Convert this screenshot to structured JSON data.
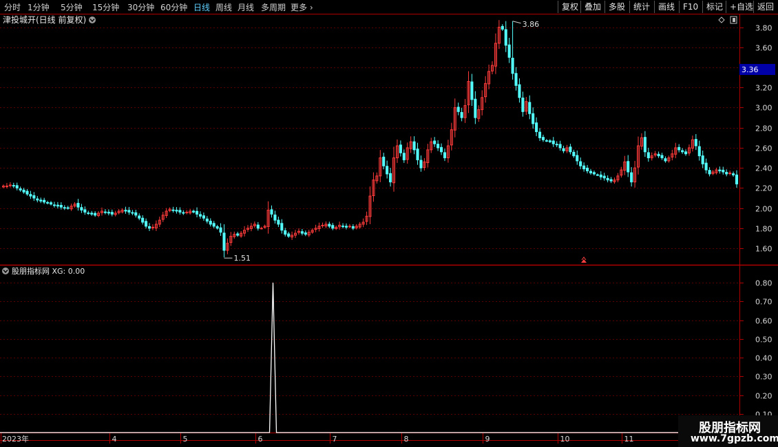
{
  "toolbar": {
    "periods": [
      {
        "label": "分时",
        "active": false
      },
      {
        "label": "1分钟",
        "active": false
      },
      {
        "label": "5分钟",
        "active": false
      },
      {
        "label": "15分钟",
        "active": false
      },
      {
        "label": "30分钟",
        "active": false
      },
      {
        "label": "60分钟",
        "active": false
      },
      {
        "label": "日线",
        "active": true
      },
      {
        "label": "周线",
        "active": false
      },
      {
        "label": "月线",
        "active": false
      },
      {
        "label": "多周期",
        "active": false
      },
      {
        "label": "更多",
        "active": false
      }
    ],
    "actions": [
      "复权",
      "叠加",
      "多股",
      "统计",
      "画线",
      "F10",
      "标记",
      "+自选",
      "返回"
    ]
  },
  "main_panel": {
    "title": "津投城开(日线 前复权)",
    "current_price_tag": "3.36",
    "high_label": "3.86",
    "low_label": "1.51"
  },
  "indicator_panel": {
    "title": "股朋指标网 XG: 0.00"
  },
  "watermark": {
    "line1": "股朋指标网",
    "line2": "www.7gpzb.com"
  },
  "colors": {
    "up": "#ff3b3b",
    "down": "#54ffff",
    "grid": "#5a0000",
    "frame": "#b00000",
    "indicator": "#ffffff",
    "price_tag_bg": "#0000a8"
  },
  "chart_data": [
    {
      "type": "candlestick",
      "title": "",
      "x_tick_labels": [
        "2023年",
        "4",
        "5",
        "6",
        "7",
        "8",
        "9",
        "10",
        "11"
      ],
      "ylim": [
        1.45,
        3.92
      ],
      "y_ticks": [
        1.6,
        1.8,
        2.0,
        2.2,
        2.4,
        2.6,
        2.8,
        3.0,
        3.2,
        3.4,
        3.6,
        3.8
      ],
      "y_tick_labels": [
        "1.60",
        "1.80",
        "2.00",
        "2.20",
        "2.40",
        "2.60",
        "2.80",
        "3.00",
        "3.20",
        "3.40",
        "3.60",
        "3.80"
      ],
      "month_start_index": {
        "4": 32,
        "5": 53,
        "6": 75,
        "7": 97,
        "8": 118,
        "9": 142,
        "10": 164,
        "11": 183
      },
      "high": 3.86,
      "low": 1.51,
      "closes": [
        2.22,
        2.22,
        2.23,
        2.22,
        2.2,
        2.18,
        2.16,
        2.14,
        2.12,
        2.1,
        2.08,
        2.07,
        2.06,
        2.05,
        2.04,
        2.03,
        2.02,
        2.01,
        2.0,
        2.0,
        2.02,
        2.04,
        2.01,
        1.98,
        1.96,
        1.95,
        1.94,
        1.93,
        1.95,
        1.97,
        1.96,
        1.95,
        1.94,
        1.95,
        1.97,
        1.98,
        1.97,
        1.96,
        1.95,
        1.93,
        1.9,
        1.86,
        1.82,
        1.8,
        1.81,
        1.84,
        1.88,
        1.93,
        1.97,
        1.99,
        1.98,
        1.97,
        1.96,
        1.95,
        1.96,
        1.97,
        1.96,
        1.94,
        1.92,
        1.9,
        1.87,
        1.84,
        1.82,
        1.8,
        1.76,
        1.58,
        1.65,
        1.72,
        1.74,
        1.73,
        1.75,
        1.78,
        1.8,
        1.82,
        1.84,
        1.8,
        1.8,
        1.82,
        1.98,
        1.94,
        1.88,
        1.84,
        1.78,
        1.74,
        1.72,
        1.73,
        1.75,
        1.77,
        1.75,
        1.74,
        1.76,
        1.78,
        1.8,
        1.82,
        1.83,
        1.84,
        1.82,
        1.8,
        1.81,
        1.83,
        1.82,
        1.81,
        1.82,
        1.8,
        1.82,
        1.84,
        1.86,
        1.92,
        2.12,
        2.28,
        2.32,
        2.5,
        2.42,
        2.34,
        2.26,
        2.5,
        2.62,
        2.55,
        2.48,
        2.6,
        2.66,
        2.58,
        2.48,
        2.4,
        2.46,
        2.58,
        2.66,
        2.64,
        2.6,
        2.56,
        2.5,
        2.62,
        2.78,
        3.0,
        2.96,
        2.9,
        3.02,
        3.26,
        3.08,
        2.9,
        2.98,
        3.1,
        3.24,
        3.36,
        3.42,
        3.64,
        3.8,
        3.78,
        3.62,
        3.5,
        3.34,
        3.22,
        3.1,
        2.96,
        3.06,
        2.94,
        2.84,
        2.76,
        2.7,
        2.68,
        2.67,
        2.66,
        2.64,
        2.63,
        2.6,
        2.57,
        2.6,
        2.56,
        2.52,
        2.47,
        2.42,
        2.39,
        2.37,
        2.35,
        2.34,
        2.33,
        2.31,
        2.3,
        2.28,
        2.27,
        2.28,
        2.32,
        2.38,
        2.46,
        2.36,
        2.26,
        2.4,
        2.62,
        2.7,
        2.56,
        2.5,
        2.52,
        2.54,
        2.52,
        2.5,
        2.47,
        2.5,
        2.54,
        2.6,
        2.58,
        2.56,
        2.54,
        2.6,
        2.68,
        2.62,
        2.52,
        2.44,
        2.38,
        2.34,
        2.36,
        2.38,
        2.37,
        2.36,
        2.34,
        2.35,
        2.33,
        2.24
      ]
    },
    {
      "type": "line",
      "title": "",
      "series": [
        {
          "values": [
            0,
            0,
            0,
            0,
            0,
            0,
            0,
            0,
            0,
            0,
            0,
            0,
            0,
            0,
            0,
            0,
            0,
            0,
            0,
            0,
            0,
            0,
            0,
            0,
            0,
            0,
            0,
            0,
            0,
            0,
            0,
            0,
            0,
            0,
            0,
            0,
            0,
            0,
            0,
            0,
            0,
            0,
            0,
            0,
            0,
            0,
            0,
            0,
            0,
            0,
            0,
            0,
            0,
            0,
            0,
            0,
            0,
            0,
            0,
            0,
            0,
            0,
            0,
            0,
            0,
            0,
            0,
            0,
            0,
            0,
            0,
            0,
            0,
            0,
            0,
            0,
            0,
            0,
            0,
            0,
            0,
            0,
            0,
            0,
            0,
            0,
            0,
            0,
            0,
            0,
            0,
            0,
            0,
            0,
            0,
            0,
            0,
            0,
            0,
            0,
            0,
            0,
            0,
            0,
            0,
            0,
            0,
            0,
            0,
            0,
            0,
            0,
            0,
            0,
            0,
            0,
            0,
            0,
            0,
            0,
            0,
            0,
            0,
            0,
            0,
            0,
            0,
            0,
            0,
            0,
            0,
            0,
            0,
            0,
            0,
            0,
            0,
            0,
            0,
            0,
            0,
            0,
            0,
            0,
            0,
            0,
            0,
            0,
            0,
            0,
            0,
            0,
            0,
            0,
            0,
            0,
            0,
            0,
            0,
            0,
            0,
            0,
            0,
            0,
            0,
            0,
            0,
            0,
            0,
            0,
            0,
            0,
            0,
            0,
            0,
            0,
            0,
            0,
            0,
            0,
            0,
            0,
            0,
            0,
            0,
            0,
            0,
            0,
            0,
            0,
            0,
            0,
            0,
            0,
            0,
            0,
            0,
            0,
            0,
            0,
            0,
            0,
            0,
            0,
            0,
            0,
            0,
            0,
            0,
            0,
            0,
            0,
            0,
            0,
            0,
            0,
            0,
            0,
            0,
            0,
            0,
            0,
            0,
            0,
            0,
            0
          ],
          "spike": {
            "index": 79,
            "value": 0.8
          }
        }
      ],
      "ylim": [
        0,
        0.87
      ],
      "y_ticks": [
        0.1,
        0.2,
        0.3,
        0.4,
        0.5,
        0.6,
        0.7,
        0.8
      ],
      "y_tick_labels": [
        "0.10",
        "0.20",
        "0.30",
        "0.40",
        "0.50",
        "0.60",
        "0.70",
        "0.80"
      ]
    }
  ]
}
